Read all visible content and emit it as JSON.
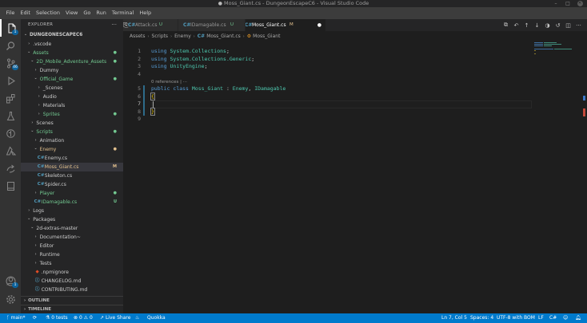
{
  "window": {
    "title": "Moss_Giant.cs - DungeonEscapeC6 - Visual Studio Code",
    "modified_dot": "●",
    "controls": {
      "minimize": "–",
      "maximize": "□",
      "close": "✕"
    }
  },
  "menu": [
    "File",
    "Edit",
    "Selection",
    "View",
    "Go",
    "Run",
    "Terminal",
    "Help"
  ],
  "activity_bar": {
    "items": [
      {
        "name": "explorer",
        "icon": "files-icon",
        "badge": "1"
      },
      {
        "name": "search",
        "icon": "search-icon"
      },
      {
        "name": "source-control",
        "icon": "source-control-icon",
        "badge": "46"
      },
      {
        "name": "run-debug",
        "icon": "run-debug-icon"
      },
      {
        "name": "extensions",
        "icon": "extensions-icon"
      },
      {
        "name": "testing",
        "icon": "flask-icon"
      },
      {
        "name": "git-graph",
        "icon": "git-graph-icon"
      },
      {
        "name": "azure",
        "icon": "azure-icon"
      },
      {
        "name": "live-share",
        "icon": "live-share-icon"
      },
      {
        "name": "notebook",
        "icon": "notebook-icon"
      }
    ],
    "bottom": [
      {
        "name": "accounts",
        "icon": "account-icon",
        "badge": "1"
      },
      {
        "name": "manage",
        "icon": "gear-icon"
      }
    ]
  },
  "sidebar": {
    "header": "EXPLORER",
    "more": "···",
    "tree": [
      {
        "label": "DUNGEONESCAPEC6",
        "depth": 0,
        "kind": "root",
        "open": true
      },
      {
        "label": ".vscode",
        "depth": 1,
        "kind": "folder",
        "open": false
      },
      {
        "label": "Assets",
        "depth": 1,
        "kind": "folder",
        "open": true,
        "color": "#73c991",
        "status": "●"
      },
      {
        "label": "2D_Mobile_Adventure_Assets",
        "depth": 2,
        "kind": "folder",
        "open": true,
        "color": "#73c991",
        "status": "●"
      },
      {
        "label": "Dummy",
        "depth": 3,
        "kind": "folder",
        "open": false
      },
      {
        "label": "Official_Game",
        "depth": 3,
        "kind": "folder",
        "open": true,
        "color": "#73c991",
        "status": "●"
      },
      {
        "label": "_Scenes",
        "depth": 4,
        "kind": "folder",
        "open": false
      },
      {
        "label": "Audio",
        "depth": 4,
        "kind": "folder",
        "open": false
      },
      {
        "label": "Materials",
        "depth": 4,
        "kind": "folder",
        "open": false
      },
      {
        "label": "Sprites",
        "depth": 4,
        "kind": "folder",
        "open": false,
        "color": "#73c991",
        "status": "●"
      },
      {
        "label": "Scenes",
        "depth": 2,
        "kind": "folder",
        "open": false
      },
      {
        "label": "Scripts",
        "depth": 2,
        "kind": "folder",
        "open": true,
        "color": "#73c991",
        "status": "●"
      },
      {
        "label": "Animation",
        "depth": 3,
        "kind": "folder",
        "open": false
      },
      {
        "label": "Enemy",
        "depth": 3,
        "kind": "folder",
        "open": true,
        "color": "#e2c08d",
        "status": "●"
      },
      {
        "label": "Enemy.cs",
        "depth": 4,
        "kind": "cs"
      },
      {
        "label": "Moss_Giant.cs",
        "depth": 4,
        "kind": "cs",
        "color": "#e2c08d",
        "status": "M",
        "selected": true
      },
      {
        "label": "Skeleton.cs",
        "depth": 4,
        "kind": "cs"
      },
      {
        "label": "Spider.cs",
        "depth": 4,
        "kind": "cs"
      },
      {
        "label": "Player",
        "depth": 3,
        "kind": "folder",
        "open": false,
        "color": "#73c991",
        "status": "●"
      },
      {
        "label": "IDamagable.cs",
        "depth": 3,
        "kind": "cs",
        "color": "#73c991",
        "status": "U"
      },
      {
        "label": "Logs",
        "depth": 1,
        "kind": "folder",
        "open": false
      },
      {
        "label": "Packages",
        "depth": 1,
        "kind": "folder",
        "open": true
      },
      {
        "label": "2d-extras-master",
        "depth": 2,
        "kind": "folder",
        "open": true
      },
      {
        "label": "Documentation~",
        "depth": 3,
        "kind": "folder",
        "open": false
      },
      {
        "label": "Editor",
        "depth": 3,
        "kind": "folder",
        "open": false
      },
      {
        "label": "Runtime",
        "depth": 3,
        "kind": "folder",
        "open": false
      },
      {
        "label": "Tests",
        "depth": 3,
        "kind": "folder",
        "open": false
      },
      {
        "label": ".npmignore",
        "depth": 3,
        "kind": "git"
      },
      {
        "label": "CHANGELOG.md",
        "depth": 3,
        "kind": "md"
      },
      {
        "label": "CONTRIBUTING.md",
        "depth": 3,
        "kind": "md"
      }
    ],
    "sections": [
      "OUTLINE",
      "TIMELINE"
    ]
  },
  "tabs": [
    {
      "label": "Attack.cs",
      "status": "U",
      "active": false,
      "status_color": "#73c991"
    },
    {
      "label": "IDamagable.cs",
      "status": "U",
      "active": false,
      "status_color": "#73c991"
    },
    {
      "label": "Moss_Giant.cs",
      "status": "M",
      "active": true,
      "status_color": "#e2c08d",
      "dirty": "●"
    }
  ],
  "breadcrumb": {
    "parts": [
      "Assets",
      "Scripts",
      "Enemy"
    ],
    "file": "Moss_Giant.cs",
    "file_icon": "C#",
    "symbol": "Moss_Giant",
    "separator": "›"
  },
  "editor": {
    "current_line": 7,
    "lines": [
      {
        "n": "1",
        "tokens": [
          [
            "kw",
            "using"
          ],
          [
            "pu",
            " "
          ],
          [
            "ns",
            "System.Collections"
          ],
          [
            "pu",
            ";"
          ]
        ]
      },
      {
        "n": "2",
        "tokens": [
          [
            "kw",
            "using"
          ],
          [
            "pu",
            " "
          ],
          [
            "ns",
            "System.Collections.Generic"
          ],
          [
            "pu",
            ";"
          ]
        ]
      },
      {
        "n": "3",
        "tokens": [
          [
            "kw",
            "using"
          ],
          [
            "pu",
            " "
          ],
          [
            "ns",
            "UnityEngine"
          ],
          [
            "pu",
            ";"
          ]
        ]
      },
      {
        "n": "4",
        "tokens": []
      },
      {
        "lens": "0 references | ···"
      },
      {
        "n": "5",
        "tokens": [
          [
            "kw",
            "public"
          ],
          [
            "pu",
            " "
          ],
          [
            "kw",
            "class"
          ],
          [
            "pu",
            " "
          ],
          [
            "ty",
            "Moss_Giant"
          ],
          [
            "pu",
            " : "
          ],
          [
            "ty",
            "Enemy"
          ],
          [
            "pu",
            ", "
          ],
          [
            "ty",
            "IDamagable"
          ]
        ]
      },
      {
        "n": "6",
        "tokens": [
          [
            "brace",
            "{"
          ]
        ]
      },
      {
        "n": "7",
        "tokens": []
      },
      {
        "n": "8",
        "tokens": [
          [
            "brace",
            "}"
          ]
        ]
      },
      {
        "n": "9",
        "tokens": []
      }
    ]
  },
  "statusbar": {
    "branch": "main*",
    "sync": "⟳",
    "tests": "0 tests",
    "errors": "0",
    "warnings": "0",
    "live_share": "Live Share",
    "quokka": "Quokka",
    "position": "Ln 7, Col 5",
    "spaces": "Spaces: 4",
    "encoding": "UTF-8 with BOM",
    "eol": "LF",
    "language": "C#"
  },
  "colors": {
    "accent": "#007acc",
    "untracked": "#73c991",
    "modified": "#e2c08d",
    "csharp": "#519aba"
  }
}
